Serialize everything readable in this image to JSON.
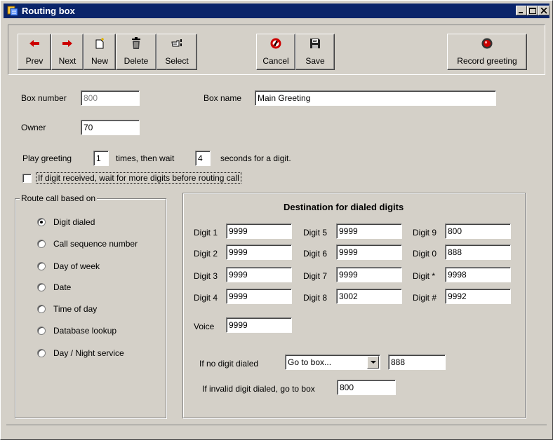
{
  "window": {
    "title": "Routing box"
  },
  "toolbar": {
    "prev": "Prev",
    "next": "Next",
    "new": "New",
    "delete": "Delete",
    "select": "Select",
    "cancel": "Cancel",
    "save": "Save",
    "record_greeting": "Record greeting"
  },
  "form": {
    "box_number_label": "Box number",
    "box_number_value": "800",
    "box_name_label": "Box name",
    "box_name_value": "Main Greeting",
    "owner_label": "Owner",
    "owner_value": "70",
    "play_greeting_label": "Play greeting",
    "play_greeting_times": "1",
    "times_then_wait": "times, then wait",
    "wait_seconds": "4",
    "seconds_for_digit": "seconds for a digit.",
    "wait_more_digits_label": "If digit received, wait for more digits before routing call",
    "wait_more_digits_checked": false
  },
  "route": {
    "legend": "Route call based on",
    "options": [
      "Digit dialed",
      "Call sequence number",
      "Day of week",
      "Date",
      "Time of day",
      "Database lookup",
      "Day / Night service"
    ],
    "selected": "Digit dialed"
  },
  "destination": {
    "title": "Destination for dialed digits",
    "digits": [
      {
        "label": "Digit 1",
        "value": "9999"
      },
      {
        "label": "Digit 2",
        "value": "9999"
      },
      {
        "label": "Digit 3",
        "value": "9999"
      },
      {
        "label": "Digit 4",
        "value": "9999"
      },
      {
        "label": "Digit 5",
        "value": "9999"
      },
      {
        "label": "Digit 6",
        "value": "9999"
      },
      {
        "label": "Digit 7",
        "value": "9999"
      },
      {
        "label": "Digit 8",
        "value": "3002"
      },
      {
        "label": "Digit 9",
        "value": "800"
      },
      {
        "label": "Digit 0",
        "value": "888"
      },
      {
        "label": "Digit *",
        "value": "9998"
      },
      {
        "label": "Digit #",
        "value": "9992"
      }
    ],
    "voice_label": "Voice",
    "voice_value": "9999",
    "no_digit_label": "If no digit dialed",
    "no_digit_action": "Go to box...",
    "no_digit_box": "888",
    "invalid_label": "If invalid digit dialed, go to box",
    "invalid_box": "800"
  },
  "colors": {
    "title_bar": "#0a246a",
    "window_bg": "#d4d0c8",
    "arrow_red": "#cc0000"
  },
  "icons": {
    "prev": "left-arrow-icon",
    "next": "right-arrow-icon",
    "new": "new-document-icon",
    "delete": "trash-icon",
    "select": "pointing-hand-icon",
    "cancel": "cancel-icon",
    "save": "save-icon",
    "record_greeting": "record-icon"
  }
}
